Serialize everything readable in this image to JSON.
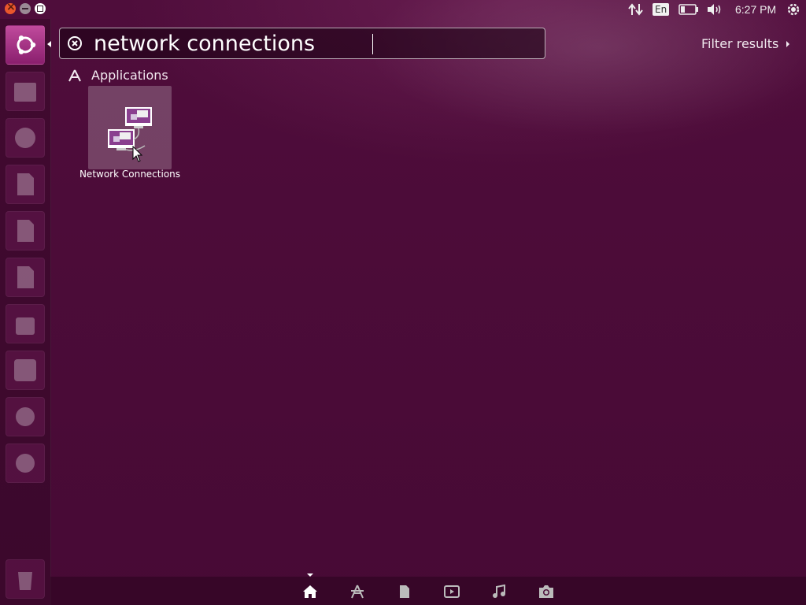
{
  "window_controls": {
    "close": "close",
    "minimize": "minimize",
    "maximize": "maximize"
  },
  "panel": {
    "language": "En",
    "clock": "6:27 PM"
  },
  "launcher": {
    "items": [
      {
        "name": "dash-home",
        "icon": "ubuntu-logo-icon"
      },
      {
        "name": "files",
        "icon": "file-cabinet-icon"
      },
      {
        "name": "firefox",
        "icon": "firefox-icon"
      },
      {
        "name": "writer",
        "icon": "document-icon"
      },
      {
        "name": "calc",
        "icon": "spreadsheet-icon"
      },
      {
        "name": "impress",
        "icon": "presentation-icon"
      },
      {
        "name": "software-center",
        "icon": "shopping-bag-icon"
      },
      {
        "name": "amazon",
        "icon": "amazon-icon"
      },
      {
        "name": "system-settings",
        "icon": "gear-wrench-icon"
      },
      {
        "name": "software-updater",
        "icon": "update-icon"
      },
      {
        "name": "trash",
        "icon": "trash-icon"
      }
    ]
  },
  "search": {
    "value": "network connections",
    "placeholder": ""
  },
  "filter": {
    "label": "Filter results"
  },
  "results": {
    "category": "Applications",
    "items": [
      {
        "label": "Network Connections",
        "icon": "network-connections-icon"
      }
    ]
  },
  "lenses": [
    "home-icon",
    "applications-icon",
    "files-icon",
    "video-icon",
    "music-icon",
    "photo-icon"
  ],
  "colors": {
    "background": "#4a0b37",
    "accent": "#c04a9c"
  }
}
